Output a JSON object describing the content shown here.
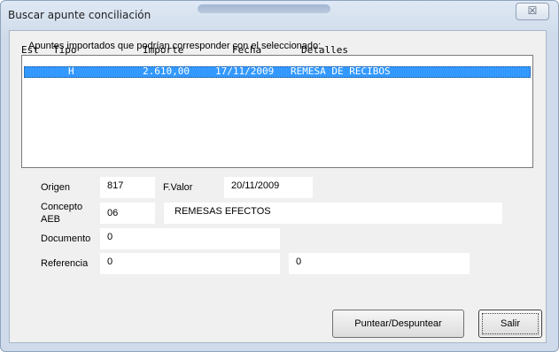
{
  "window": {
    "title": "Buscar apunte conciliación",
    "close_glyph": "☒"
  },
  "list": {
    "caption": "Apuntes importados que podrían corresponder con el seleccionado:",
    "columns": [
      "Est",
      "Tipo",
      "Importe",
      "Fecha",
      "Detalles"
    ],
    "rows": [
      {
        "est": "",
        "tipo": "H",
        "importe": "2.610,00",
        "fecha": "17/11/2009",
        "detalles": "REMESA DE RECIBOS",
        "selected": true
      }
    ]
  },
  "form": {
    "origen_label": "Origen",
    "origen_value": "817",
    "fvalor_label": "F.Valor",
    "fvalor_value": "20/11/2009",
    "concepto_label_1": "Concepto",
    "concepto_label_2": "AEB",
    "concepto_code": "06",
    "concepto_desc": "REMESAS EFECTOS",
    "documento_label": "Documento",
    "documento_value": "0",
    "referencia_label": "Referencia",
    "referencia_value": "0",
    "referencia2_value": "0"
  },
  "buttons": {
    "puntear": "Puntear/Despuntear",
    "salir": "Salir"
  },
  "colors": {
    "selection": "#3399ff",
    "dialog_bg": "#f0f0f0"
  }
}
